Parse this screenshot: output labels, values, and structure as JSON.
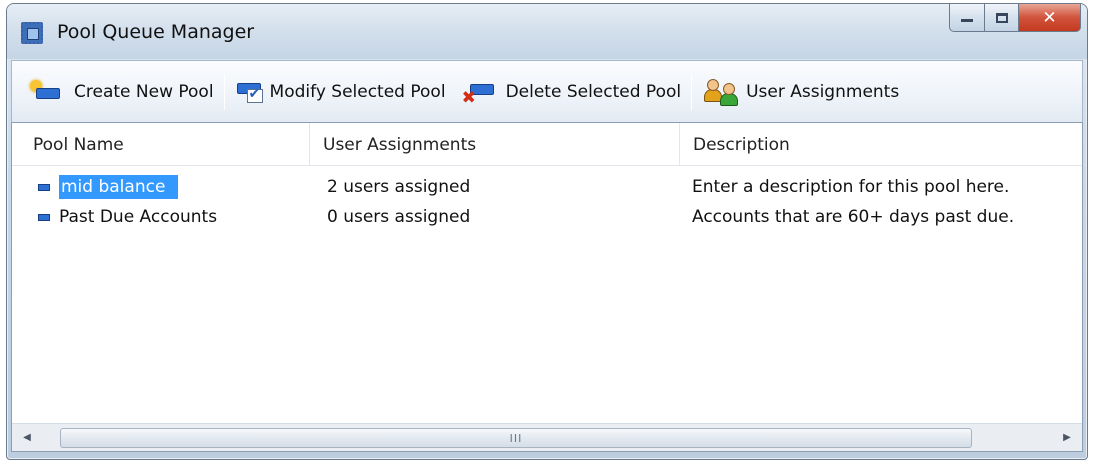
{
  "window": {
    "title": "Pool Queue Manager",
    "icon": "window-app-icon",
    "controls": {
      "minimize": "minimize-icon",
      "maximize": "maximize-icon",
      "close": "✕"
    }
  },
  "toolbar": {
    "create_label": "Create New Pool",
    "modify_label": "Modify Selected Pool",
    "delete_label": "Delete Selected Pool",
    "users_label": "User Assignments"
  },
  "table": {
    "columns": [
      "Pool Name",
      "User Assignments",
      "Description"
    ],
    "rows": [
      {
        "name": "mid balance",
        "users": "2 users assigned",
        "description": "Enter a description for this pool here.",
        "selected": true
      },
      {
        "name": "Past Due Accounts",
        "users": "0 users assigned",
        "description": "Accounts that are 60+ days past due.",
        "selected": false
      }
    ]
  },
  "scrollbar": {
    "grip": "III",
    "left_arrow": "◀",
    "right_arrow": "▶"
  },
  "colors": {
    "selection": "#3399ff",
    "close_button": "#c23a20",
    "pool_icon": "#2d6fd2"
  }
}
